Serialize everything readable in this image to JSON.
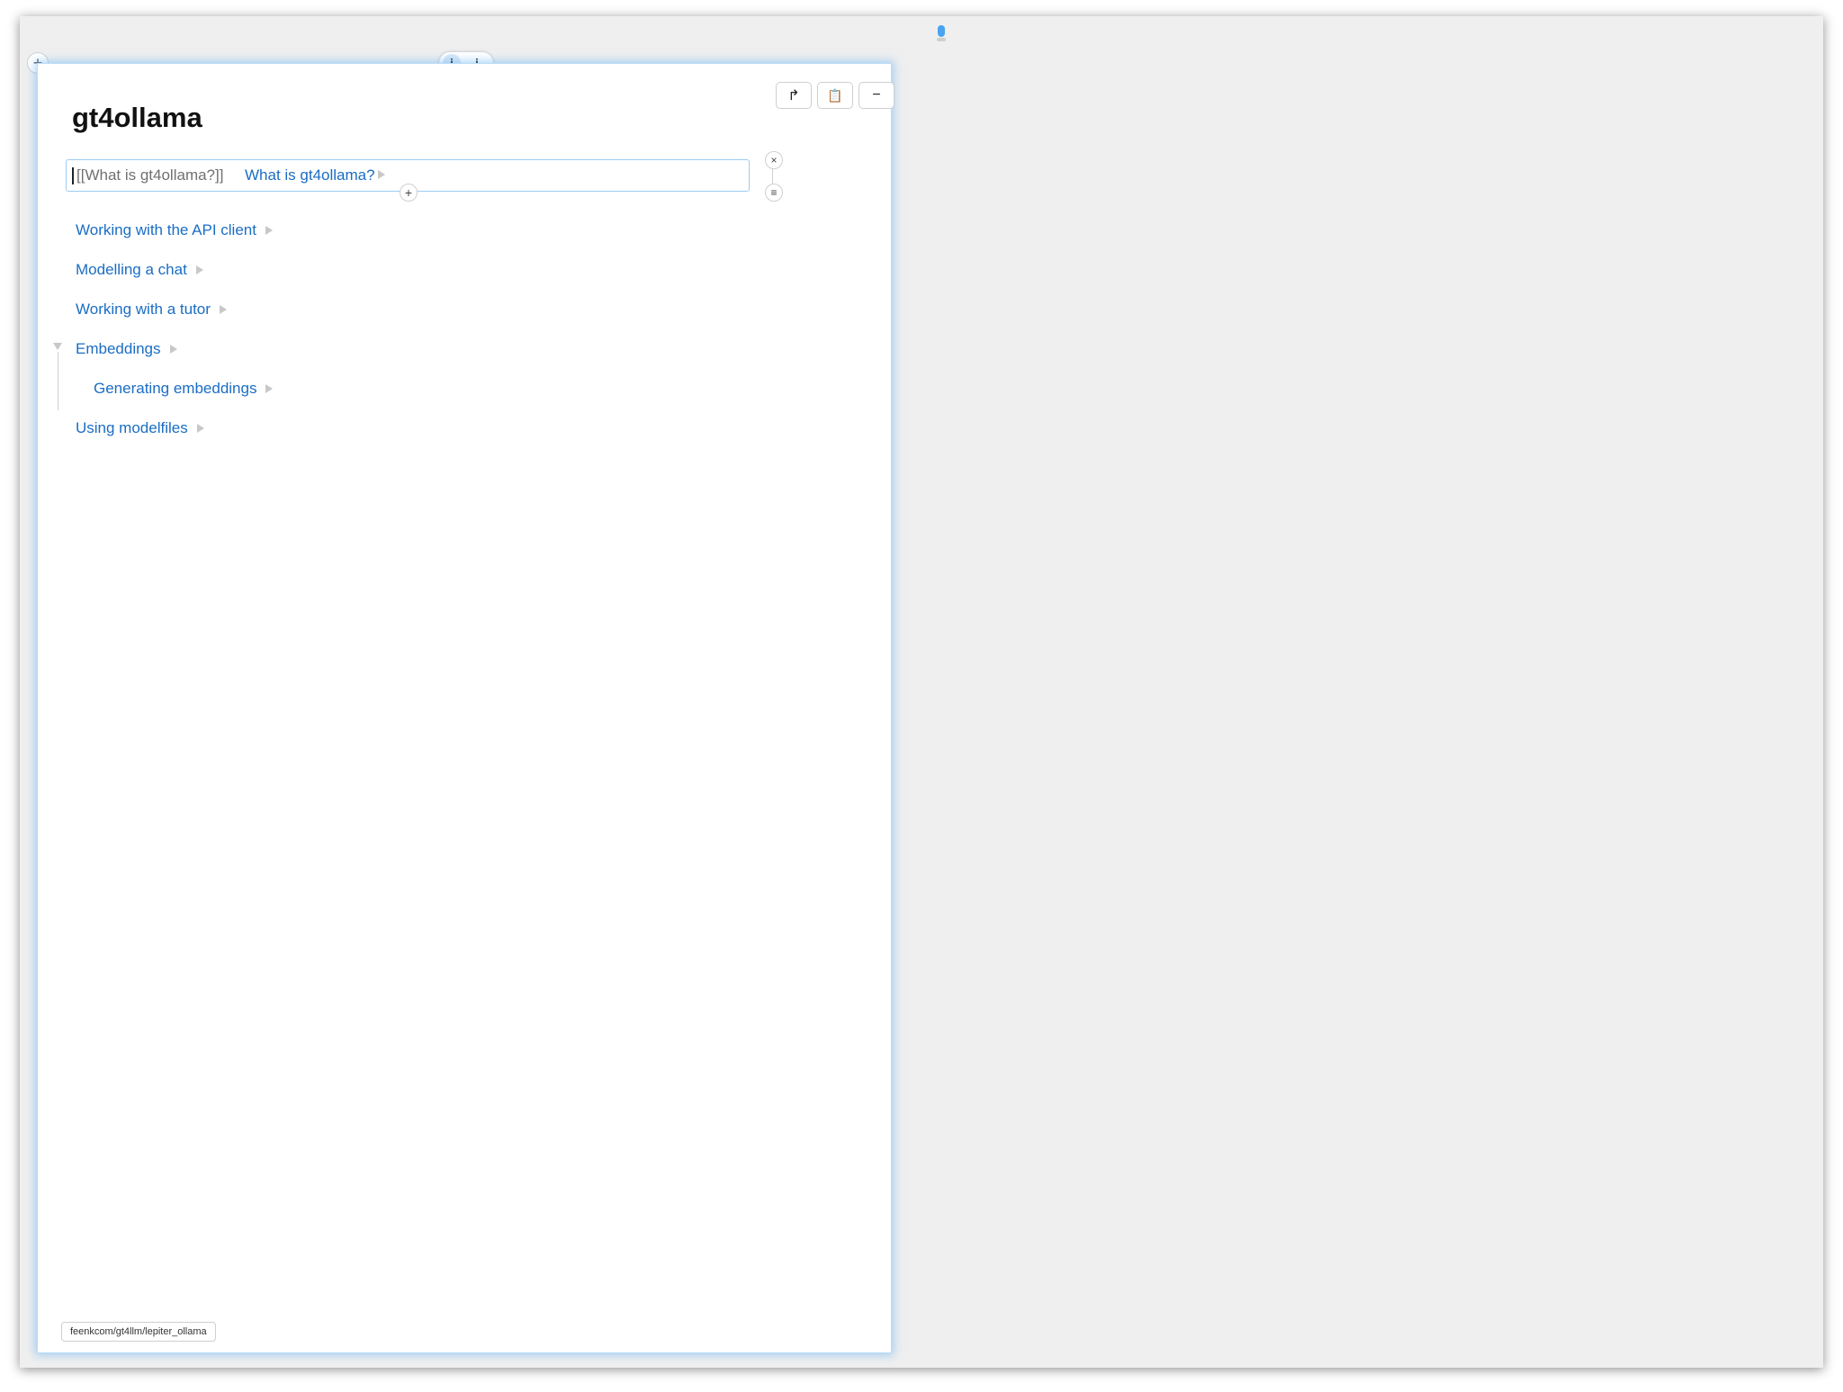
{
  "page": {
    "title": "gt4ollama",
    "repository": "feenkcom/gt4llm/lepiter_ollama"
  },
  "toolbar": {
    "share_icon": "share-arrow-icon",
    "clipboard_icon": "clipboard-icon",
    "minimize_icon": "minus-icon",
    "share_glyph": "↱",
    "clipboard_glyph": "📋",
    "minimize_glyph": "−"
  },
  "controls": {
    "plus_glyph": "+",
    "info_glyph_1": "i",
    "info_glyph_2": "i",
    "close_glyph": "×",
    "menu_glyph": "≡"
  },
  "editing_block": {
    "markup": "[[What is gt4ollama?]]",
    "link_label": "What is gt4ollama?"
  },
  "items": [
    {
      "label": "Working with the API client"
    },
    {
      "label": "Modelling a chat"
    },
    {
      "label": "Working with a tutor"
    },
    {
      "label": "Embeddings",
      "expanded": true
    },
    {
      "label": "Generating embeddings",
      "indent": 1
    },
    {
      "label": "Using modelfiles"
    }
  ],
  "colors": {
    "link": "#1a6dc4",
    "focus_border": "#9ccbf4",
    "background": "#efefef"
  }
}
